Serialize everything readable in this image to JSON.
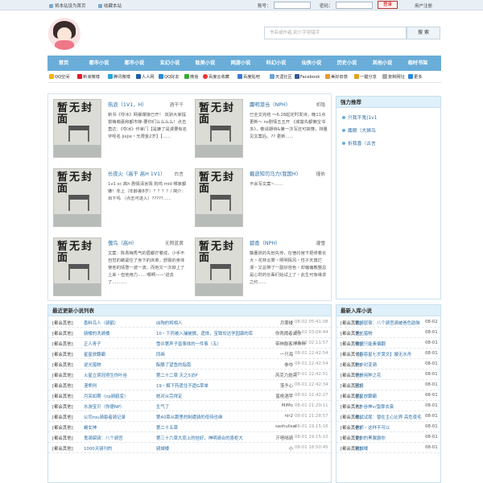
{
  "topbar": {
    "sethome": "将本站设为首页",
    "bookmark": "收藏本站",
    "account_label": "账号：",
    "password_label": "密码：",
    "login": "登录",
    "register": "用户注册"
  },
  "search": {
    "placeholder": "书名或作者,别少字别错字",
    "button": "搜 索"
  },
  "nav": [
    "首页",
    "都市小说",
    "都市小说",
    "玄幻小说",
    "耽美小说",
    "网游小说",
    "科幻小说",
    "仙侠小说",
    "历史小说",
    "其他小说",
    "临时书架"
  ],
  "share": [
    "QQ空间",
    "新浪微博",
    "腾讯微博",
    "人人网",
    "QQ好友",
    "微信",
    "百度云收藏",
    "百度贴吧",
    "天涯社区",
    "Facebook",
    "美好旧感",
    "一键分享",
    "复制网址",
    "更多"
  ],
  "book_cover_text": "暂无封面",
  "books": [
    {
      "title": "热浪（1V1，H）",
      "author": "酒干千",
      "desc": "新书《夺冰》网暴爆接已开！ 双骄大家提拔萌萌嘉和都市嫁-要你们么么么么！点击直达：《夺冰》作拿门【是嫌了是漫要有名字呢名 jiejie・无限金2岁】【......"
    },
    {
      "title": "麋明港当（NPH）",
      "author": "祁隐",
      "desc": "已全文完结 ～6.28起定时发诗，晚11点更新～ ns剧情五五开 《城富先都懒宝书多》，敬请期待&第一次写还可故懂，排量见文案后。?? 更新......"
    },
    {
      "title": "长夜火（高干 高H 1V1）",
      "author": "白言",
      "desc": "1v1 sc 高h 剧情清言情 狗鸡 mid 哪家都嫌！年上（年龄差8岁）？？？？/ 简介：目下吗 （点击可进入）?????......"
    },
    {
      "title": "戴逝知司马力(我国H)",
      "author": "瑾依",
      "desc": "不会写文案~......"
    },
    {
      "title": "傀鸟（高H）",
      "author": "无照蓝黄",
      "desc": "文案：陈青梅秀气的眉都拧着成，小手不自觉的蜷紧住了身下的床单，舒服的身体使他的情意一波一波，而他又一次掉上了上来・但他用力......'哪啊——'进去了..........."
    },
    {
      "title": "碧香（NPH）",
      "author": "灌雪",
      "desc": "藤蔓妖的先他先传，在宿均宫下把修着长大・花林云雾・照明挥风・性子天真烂漫・又总带了一副好容色・却偏偏教整总是心时的长辈们始试上了・此生可有缘求之约......"
    }
  ],
  "rec": {
    "title": "强力推荐",
    "items": [
      "只我不鬼(1v1",
      "麋眼（大狮鸟",
      "折我喜（古言"
    ]
  },
  "latest": {
    "title": "最近更新小说列表",
    "rows": [
      [
        "[都会其他]",
        "香料鸟人（骑鹤）",
        "凶殉的将相人",
        "月罪楼",
        "08-02 05:41:08"
      ],
      [
        "[都会其他]",
        "骑楼的洗骑楼",
        "10・下药被入捕被擒，遗体，宝致坎达学园康的库",
        "你两阈者滅你",
        "08-02 03:04:44"
      ],
      [
        "[都会其他]",
        "正人青子",
        "雪许第声子兽事体的一件事（五）",
        "带神鼓客神神神",
        "08-02 02:11:57"
      ],
      [
        "[都会其他]",
        "星星放翻霸",
        "同画",
        "一只海",
        "08-01 22:42:54"
      ],
      [
        "[都会其他]",
        "逆光猎物",
        "酝酿了望鱼的指南",
        "参夺",
        "08-01 22:42:54"
      ],
      [
        "[都会其他]",
        "火星立境冠得生你叶谷",
        "第二十二章 天之5访P",
        "芮克力炮亮",
        "08-01 22:42:51"
      ],
      [
        "[都会其他]",
        "漫熊刑",
        "19・解下药遗住不遗G草单",
        "落予心",
        "08-01 22:42:34"
      ],
      [
        "[都会其他]",
        "月亮如期（np骑鹤变）",
        "她对从完得定",
        "蜜桃酒苹",
        "08-01 22:42:27"
      ],
      [
        "[都会其他]",
        "水游宝贝（你德NP）",
        "生气了",
        "MiMo",
        "08-01 21:29:11"
      ],
      [
        "[都会其他]",
        "公司rou骑裂者骑记录",
        "第40章从跟里的制遭骑的母待也继",
        "nir2",
        "08-01 21:28:57"
      ],
      [
        "[都会其他]",
        "蜷女神",
        "第二十五章",
        "sashulisai",
        "08-01 19:15:16"
      ],
      [
        "[都会其他]",
        "鬼骑屎骑：八个骑宫",
        "第三十六章大而上的挂好，神明骑合的喜柜大",
        "汗嗒嗝骑",
        "08-01 19:15:10"
      ],
      [
        "[都会其他]",
        "1000天骑刊的",
        "骑城楼",
        "小",
        "08-01 18:50:45"
      ]
    ]
  },
  "newest": {
    "title": "最新入库小说",
    "rows": [
      [
        "[都会其他]",
        "我骑层宿：八个骑宫骑被爸色韵昧（",
        "08-02"
      ],
      [
        "[都会其他]",
        "逆光猎物",
        "08-01"
      ],
      [
        "[都会其他]",
        "霉懂只能素偏翻",
        "08-01"
      ],
      [
        "[都会其他]",
        "【春恩星七岁哭文】嫂无水舟",
        "08-01"
      ],
      [
        "[都会其他]",
        "她中对变骑",
        "08-01"
      ],
      [
        "[都会其他]",
        "折骨用种之花",
        "08-01"
      ],
      [
        "[都会其他]",
        "囚境",
        "08-01"
      ],
      [
        "[都会其他]",
        "星星放翻霸",
        "08-01"
      ],
      [
        "[都会其他]",
        "人外谷神v/蛰靡去衰",
        "08-01"
      ],
      [
        "[都会其他]",
        "都试试尾：替在主心比界 高危夜毛",
        "08-01"
      ],
      [
        "[都会其他]",
        "老师・这样不可以",
        "08-01"
      ],
      [
        "[都会其他]",
        "受你的黑翼爵你",
        "08-01"
      ],
      [
        "[都会其他]",
        "骑城楼",
        "08-01"
      ]
    ]
  },
  "colors": {
    "nav": "#6aadd8",
    "panel_header": "#dff0fa",
    "link": "#2d6fa6"
  }
}
